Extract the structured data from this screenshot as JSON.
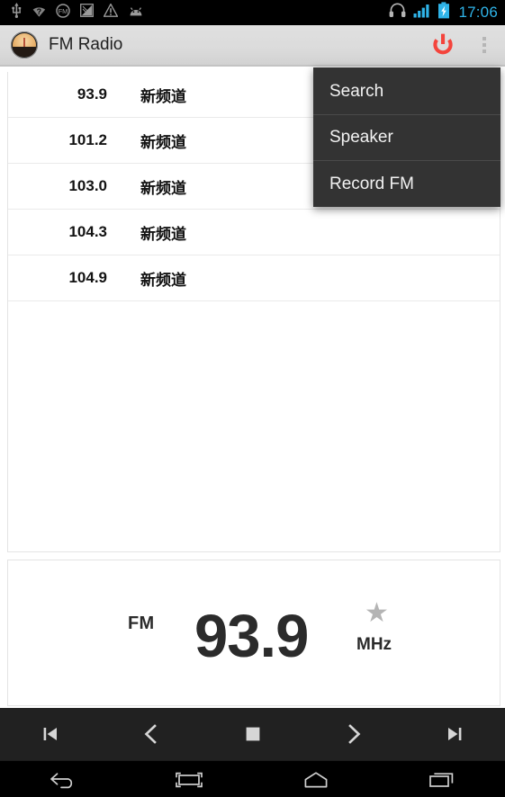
{
  "status_bar": {
    "left_icons": [
      {
        "name": "usb-debug-icon",
        "glyph": "usb"
      },
      {
        "name": "wifi-question-icon",
        "glyph": "wifi-?"
      },
      {
        "name": "fm-radio-running-icon",
        "glyph": "FM"
      },
      {
        "name": "screenshot-icon",
        "glyph": "screenshot"
      },
      {
        "name": "warning-icon",
        "glyph": "!"
      },
      {
        "name": "android-robot-icon",
        "glyph": "android"
      }
    ],
    "right_icons": [
      {
        "name": "headset-icon",
        "glyph": "headset"
      },
      {
        "name": "signal-icon",
        "glyph": "signal"
      },
      {
        "name": "battery-charging-icon",
        "glyph": "battery"
      }
    ],
    "clock": "17:06",
    "clock_color": "#2fb4e9"
  },
  "action_bar": {
    "app_icon_name": "fm-radio-app-icon",
    "title": "FM Radio",
    "power_button_label": "Power",
    "power_color": "#f4443c",
    "overflow_label": "More options"
  },
  "overflow_menu": {
    "visible": true,
    "items": [
      {
        "label": "Search",
        "name": "menu-item-search"
      },
      {
        "label": "Speaker",
        "name": "menu-item-speaker"
      },
      {
        "label": "Record FM",
        "name": "menu-item-record-fm"
      }
    ]
  },
  "station_list": [
    {
      "frequency": "93.9",
      "name": "新频道"
    },
    {
      "frequency": "101.2",
      "name": "新频道"
    },
    {
      "frequency": "103.0",
      "name": "新频道"
    },
    {
      "frequency": "104.3",
      "name": "新频道"
    },
    {
      "frequency": "104.9",
      "name": "新频道"
    }
  ],
  "frequency_display": {
    "band": "FM",
    "value": "93.9",
    "unit": "MHz",
    "favorite_glyph": "★",
    "favorite_active": false,
    "favorite_color": "#b4b4b4"
  },
  "player_controls": [
    {
      "name": "previous-station-button",
      "glyph": "skip-back"
    },
    {
      "name": "step-down-button",
      "glyph": "chevron-left"
    },
    {
      "name": "stop-button",
      "glyph": "stop"
    },
    {
      "name": "step-up-button",
      "glyph": "chevron-right"
    },
    {
      "name": "next-station-button",
      "glyph": "skip-forward"
    }
  ],
  "navigation_bar": [
    {
      "name": "nav-back-button",
      "glyph": "back"
    },
    {
      "name": "nav-screenshot-button",
      "glyph": "screenshot"
    },
    {
      "name": "nav-home-button",
      "glyph": "home"
    },
    {
      "name": "nav-recents-button",
      "glyph": "recents"
    }
  ]
}
